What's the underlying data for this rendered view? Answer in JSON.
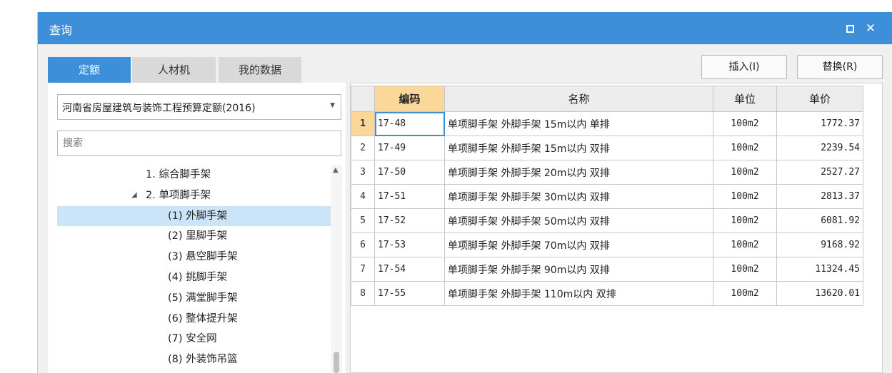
{
  "dialog": {
    "title": "查询"
  },
  "tabs": [
    "定额",
    "人材机",
    "我的数据"
  ],
  "buttons": {
    "insert": "插入(I)",
    "replace": "替换(R)"
  },
  "quota_db": {
    "selected": "河南省房屋建筑与装饰工程预算定额(2016)"
  },
  "search": {
    "placeholder": "搜索",
    "value": ""
  },
  "tree": [
    {
      "label": "1. 综合脚手架",
      "level": 1,
      "expander": ""
    },
    {
      "label": "2. 单项脚手架",
      "level": 1,
      "expander": "◢"
    },
    {
      "label": "(1) 外脚手架",
      "level": 2,
      "expander": "",
      "selected": true
    },
    {
      "label": "(2) 里脚手架",
      "level": 2,
      "expander": ""
    },
    {
      "label": "(3) 悬空脚手架",
      "level": 2,
      "expander": ""
    },
    {
      "label": "(4) 挑脚手架",
      "level": 2,
      "expander": ""
    },
    {
      "label": "(5) 满堂脚手架",
      "level": 2,
      "expander": ""
    },
    {
      "label": "(6) 整体提升架",
      "level": 2,
      "expander": ""
    },
    {
      "label": "(7) 安全网",
      "level": 2,
      "expander": ""
    },
    {
      "label": "(8) 外装饰吊篮",
      "level": 2,
      "expander": ""
    }
  ],
  "grid": {
    "columns": [
      "编码",
      "名称",
      "单位",
      "单价"
    ],
    "rows": [
      {
        "no": "1",
        "code": "17-48",
        "name": "单项脚手架 外脚手架 15m以内 单排",
        "unit": "100m2",
        "price": "1772.37"
      },
      {
        "no": "2",
        "code": "17-49",
        "name": "单项脚手架 外脚手架 15m以内 双排",
        "unit": "100m2",
        "price": "2239.54"
      },
      {
        "no": "3",
        "code": "17-50",
        "name": "单项脚手架 外脚手架 20m以内 双排",
        "unit": "100m2",
        "price": "2527.27"
      },
      {
        "no": "4",
        "code": "17-51",
        "name": "单项脚手架 外脚手架 30m以内 双排",
        "unit": "100m2",
        "price": "2813.37"
      },
      {
        "no": "5",
        "code": "17-52",
        "name": "单项脚手架 外脚手架 50m以内 双排",
        "unit": "100m2",
        "price": "6081.92"
      },
      {
        "no": "6",
        "code": "17-53",
        "name": "单项脚手架 外脚手架 70m以内 双排",
        "unit": "100m2",
        "price": "9168.92"
      },
      {
        "no": "7",
        "code": "17-54",
        "name": "单项脚手架 外脚手架 90m以内 双排",
        "unit": "100m2",
        "price": "11324.45"
      },
      {
        "no": "8",
        "code": "17-55",
        "name": "单项脚手架 外脚手架 110m以内 双排",
        "unit": "100m2",
        "price": "13620.01"
      }
    ]
  }
}
